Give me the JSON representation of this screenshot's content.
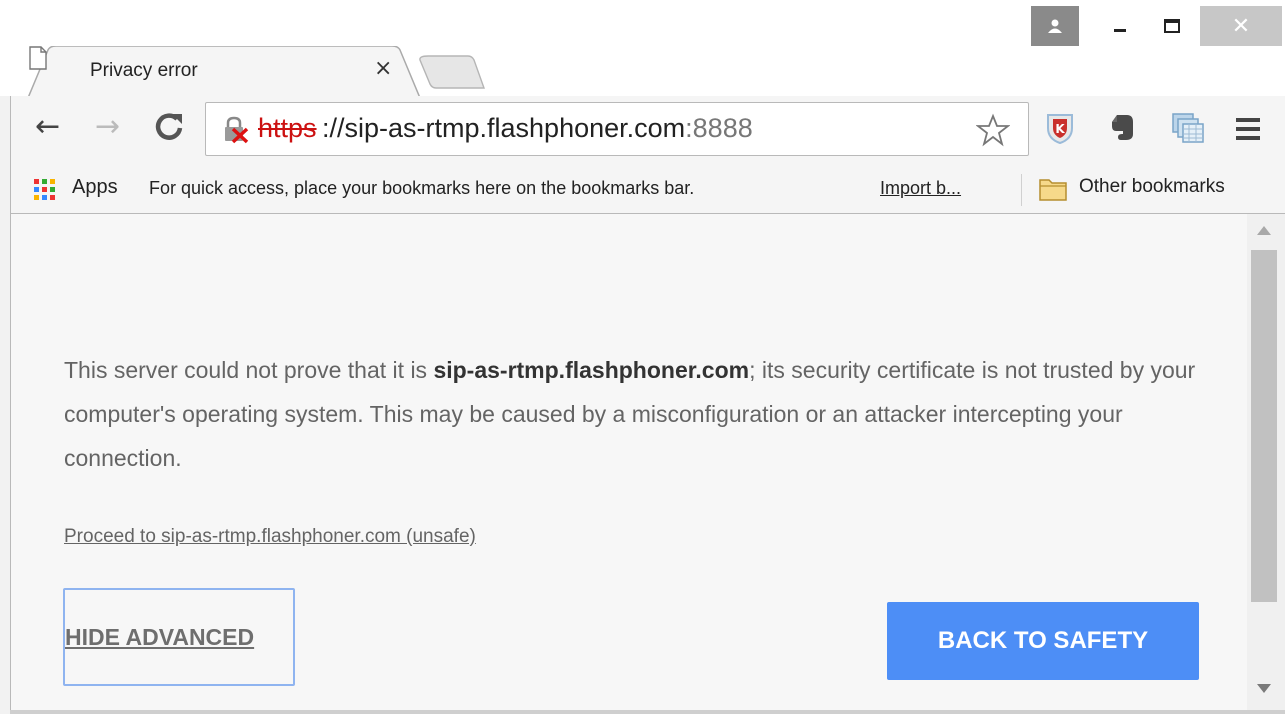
{
  "window": {
    "close_glyph": "✕"
  },
  "tab": {
    "title": "Privacy error",
    "close_glyph": "×"
  },
  "toolbar": {
    "back_glyph": "←",
    "forward_glyph": "→",
    "reload_glyph": "C",
    "url_scheme": "https",
    "url_host": "://sip-as-rtmp.flashphoner.com",
    "url_port": ":8888",
    "extensions": [
      "kaspersky-icon",
      "evernote-icon",
      "tabs-ext-icon"
    ]
  },
  "bookmarks": {
    "apps_label": "Apps",
    "hint": "For quick access, place your bookmarks here on the bookmarks bar.",
    "import_label": "Import b...",
    "other_label": "Other bookmarks"
  },
  "content": {
    "msg_before": "This server could not prove that it is ",
    "msg_host": "sip-as-rtmp.flashphoner.com",
    "msg_after": "; its security certificate is not trusted by your computer's operating system. This may be caused by a misconfiguration or an attacker intercepting your connection.",
    "proceed_link": "Proceed to sip-as-rtmp.flashphoner.com (unsafe)",
    "hide_advanced": "HIDE ADVANCED",
    "back_to_safety": "BACK TO SAFETY"
  },
  "colors": {
    "primary_button": "#4d8ef6",
    "insecure_scheme": "#cc1111"
  }
}
